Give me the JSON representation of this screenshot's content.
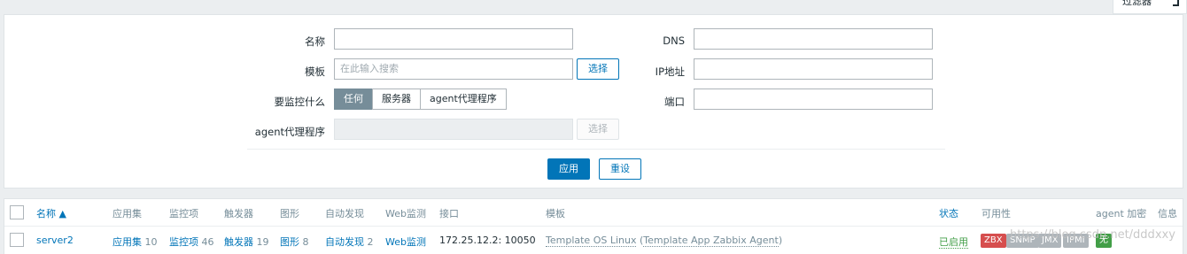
{
  "filter_toggle": {
    "label": "过滤器"
  },
  "filter": {
    "name_label": "名称",
    "name_value": "",
    "template_label": "模板",
    "template_placeholder": "在此输入搜索",
    "template_select": "选择",
    "monitor_what_label": "要监控什么",
    "monitor_options": [
      "任何",
      "服务器",
      "agent代理程序"
    ],
    "monitor_selected": "任何",
    "proxy_label": "agent代理程序",
    "proxy_select": "选择",
    "dns_label": "DNS",
    "dns_value": "",
    "ip_label": "IP地址",
    "ip_value": "",
    "port_label": "端口",
    "port_value": "",
    "apply_button": "应用",
    "reset_button": "重设"
  },
  "table": {
    "headers": {
      "name": "名称 ▲",
      "apps": "应用集",
      "items": "监控项",
      "triggers": "触发器",
      "graphs": "图形",
      "discovery": "自动发现",
      "web": "Web监测",
      "interface": "接口",
      "templates": "模板",
      "status": "状态",
      "availability": "可用性",
      "encryption": "agent 加密",
      "info": "信息"
    },
    "rows": [
      {
        "name": "server2",
        "apps_label": "应用集",
        "apps_count": "10",
        "items_label": "监控项",
        "items_count": "46",
        "triggers_label": "触发器",
        "triggers_count": "19",
        "graphs_label": "图形",
        "graphs_count": "8",
        "discovery_label": "自动发现",
        "discovery_count": "2",
        "web_label": "Web监测",
        "interface": "172.25.12.2: 10050",
        "template_main": "Template OS Linux",
        "template_open": " (",
        "template_linked": "Template App Zabbix Agent",
        "template_close": ")",
        "status": "已启用",
        "availability": [
          "ZBX",
          "SNMP",
          "JMX",
          "IPMI"
        ],
        "encryption": "无"
      }
    ]
  },
  "colors": {
    "accent": "#0275b8",
    "zbx_unavailable": "#d64e4e",
    "unknown": "#aeb5ba",
    "enabled": "#429e47"
  },
  "watermark": "https://blog.csdn.net/dddxxy"
}
